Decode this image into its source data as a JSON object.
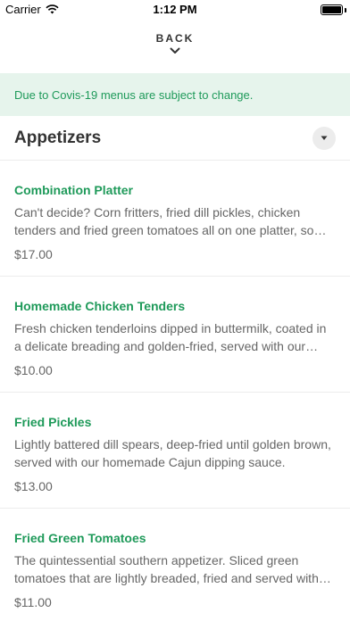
{
  "status_bar": {
    "carrier": "Carrier",
    "time": "1:12 PM"
  },
  "nav": {
    "back_label": "BACK"
  },
  "notice": {
    "text": "Due to Covis-19 menus are subject to change."
  },
  "section": {
    "title": "Appetizers"
  },
  "items": [
    {
      "name": "Combination Platter",
      "description": "Can't decide? Corn fritters, fried dill pickles, chicken tenders and fried green tomatoes all on one platter, some of each.",
      "price": "$17.00"
    },
    {
      "name": "Homemade Chicken Tenders",
      "description": "Fresh chicken tenderloins dipped in buttermilk, coated in a delicate breading and golden-fried, served with our homemade honey mustard.",
      "price": "$10.00"
    },
    {
      "name": "Fried Pickles",
      "description": "Lightly battered dill spears, deep-fried until golden brown, served with our homemade Cajun dipping sauce.",
      "price": "$13.00"
    },
    {
      "name": "Fried Green Tomatoes",
      "description": "The quintessential southern appetizer. Sliced green tomatoes that are lightly breaded, fried and served with our remoulade.",
      "price": "$11.00"
    }
  ],
  "colors": {
    "accent": "#1f9a5a",
    "notice_bg": "#e6f4ec"
  }
}
